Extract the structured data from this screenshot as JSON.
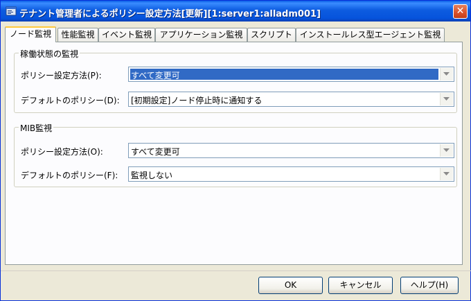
{
  "window": {
    "title": "テナント管理者によるポリシー設定方法[更新][1:server1:alladm001]",
    "close_glyph": "✕"
  },
  "tabs": [
    {
      "label": "ノード監視",
      "active": true
    },
    {
      "label": "性能監視"
    },
    {
      "label": "イベント監視"
    },
    {
      "label": "アプリケーション監視"
    },
    {
      "label": "スクリプト"
    },
    {
      "label": "インストールレス型エージェント監視"
    }
  ],
  "groups": {
    "operation": {
      "title": "稼働状態の監視",
      "policy_method_label": "ポリシー設定方法(P):",
      "policy_method_value": "すべて変更可",
      "default_policy_label": "デフォルトのポリシー(D):",
      "default_policy_value": "[初期設定]ノード停止時に通知する"
    },
    "mib": {
      "title": "MIB監視",
      "policy_method_label": "ポリシー設定方法(O):",
      "policy_method_value": "すべて変更可",
      "default_policy_label": "デフォルトのポリシー(F):",
      "default_policy_value": "監視しない"
    }
  },
  "buttons": {
    "ok": "OK",
    "cancel": "キャンセル",
    "help": "ヘルプ(H)"
  },
  "colors": {
    "titlebar": "#0653dc",
    "selection": "#316ac5",
    "active_tab_accent": "#ffc83c"
  },
  "icons": {
    "title": "settings-window-icon",
    "close": "close-icon",
    "dropdown": "chevron-down-icon"
  }
}
